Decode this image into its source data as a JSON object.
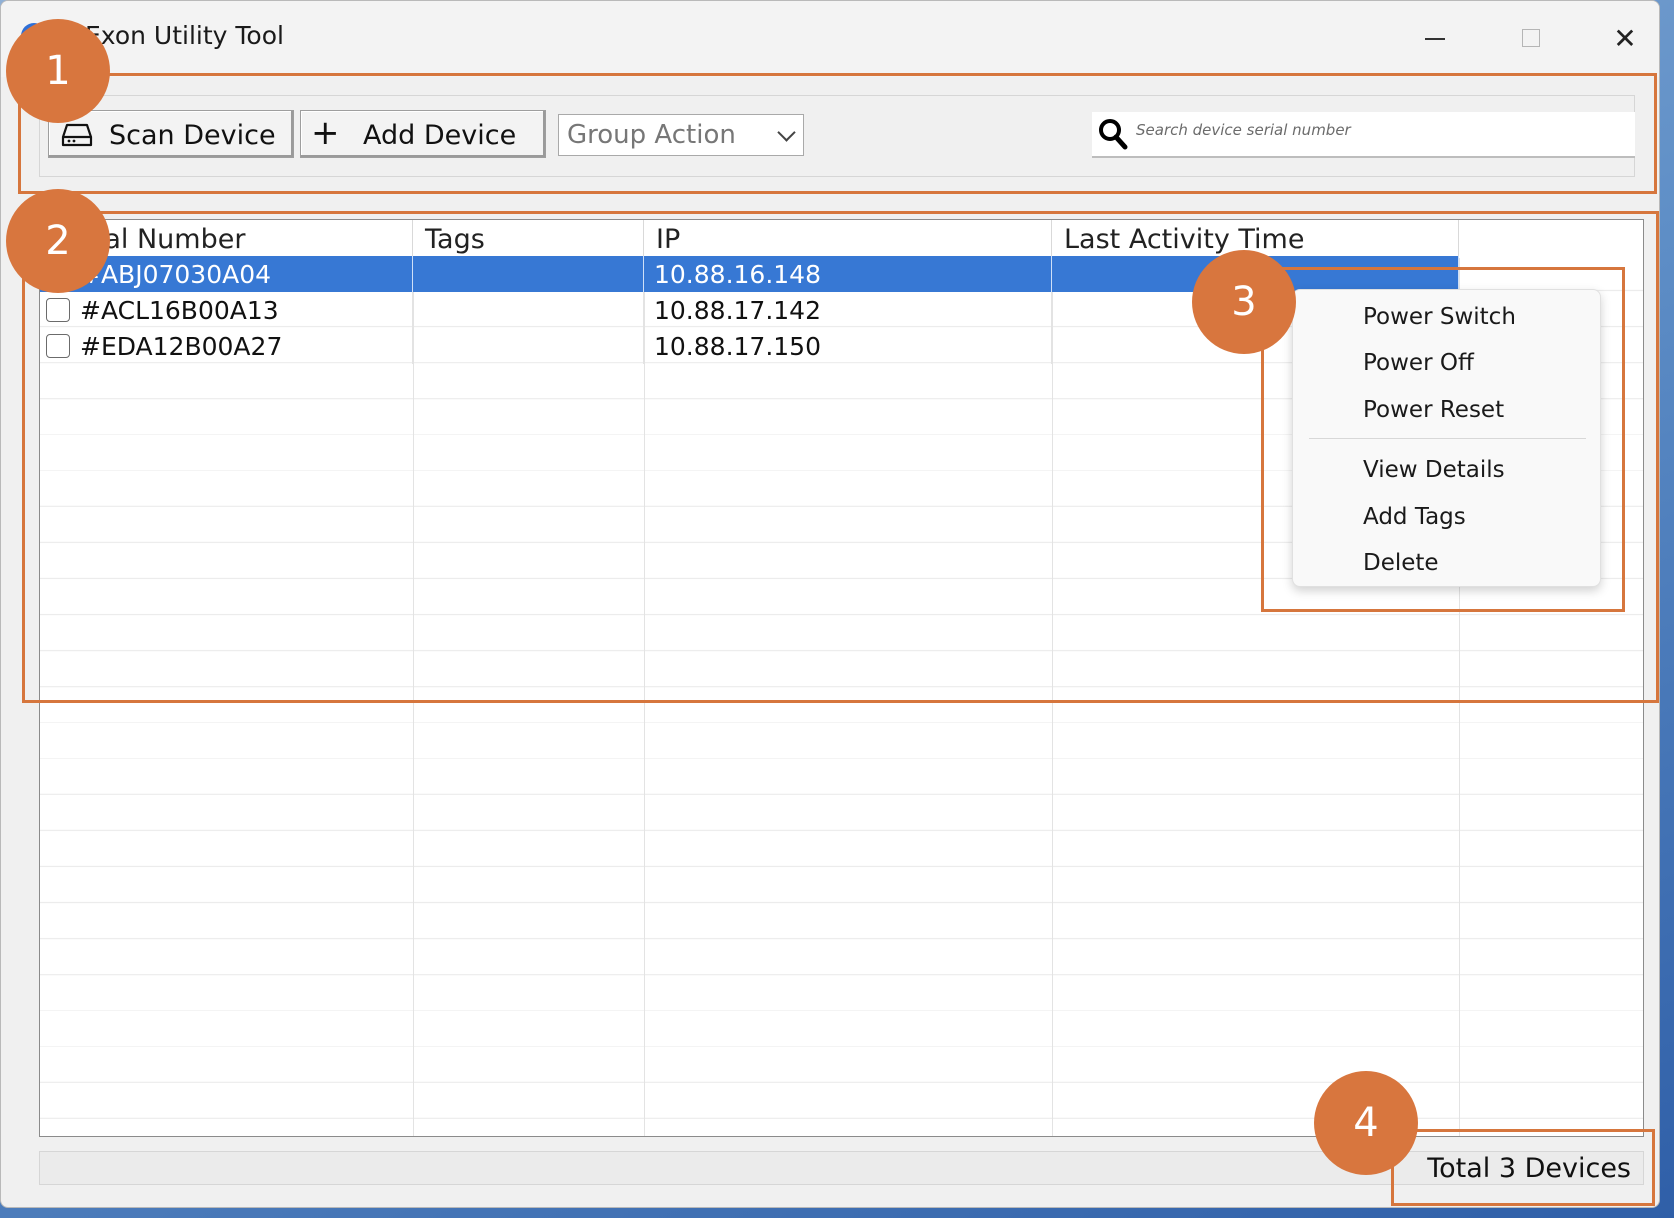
{
  "window": {
    "title": "Exon Utility Tool",
    "controls": [
      "minimize",
      "maximize",
      "close"
    ]
  },
  "toolbar": {
    "scan_label": "Scan Device",
    "scan_icon": "hard-drive-icon",
    "add_label": "Add Device",
    "add_icon": "plus-icon",
    "group_action": "Group Action",
    "search_placeholder": "Search device serial number",
    "search_icon": "search-icon"
  },
  "table": {
    "columns": [
      "Serial Number",
      "Tags",
      "IP",
      "Last Activity Time"
    ],
    "rows": [
      {
        "serial": "#ABJ07030A04",
        "tags": "",
        "ip": "10.88.16.148",
        "last_activity": "",
        "selected": true
      },
      {
        "serial": "#ACL16B00A13",
        "tags": "",
        "ip": "10.88.17.142",
        "last_activity": "",
        "selected": false
      },
      {
        "serial": "#EDA12B00A27",
        "tags": "",
        "ip": "10.88.17.150",
        "last_activity": "",
        "selected": false
      }
    ]
  },
  "context_menu": {
    "items": [
      "Power Switch",
      "Power Off",
      "Power Reset",
      "View Details",
      "Add Tags",
      "Delete"
    ]
  },
  "status": {
    "total": "Total 3 Devices"
  },
  "callouts": [
    "1",
    "2",
    "3",
    "4"
  ],
  "colors": {
    "callout": "#d8763e",
    "selection": "#3778d4"
  }
}
